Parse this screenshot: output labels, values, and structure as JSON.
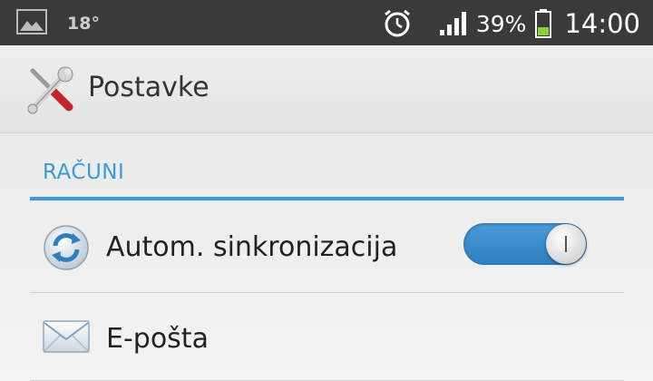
{
  "status_bar": {
    "temperature": "18°",
    "battery_percent": "39%",
    "time": "14:00",
    "icons": [
      "gallery-icon",
      "alarm-icon",
      "signal-icon",
      "battery-icon"
    ]
  },
  "action_bar": {
    "title": "Postavke",
    "icon": "settings-tools-icon"
  },
  "section": {
    "header": "RAČUNI",
    "items": [
      {
        "label": "Autom. sinkronizacija",
        "icon": "sync-icon",
        "toggle_on": true
      },
      {
        "label": "E-pošta",
        "icon": "email-envelope-icon"
      }
    ]
  },
  "colors": {
    "accent": "#3a9ad9",
    "status_bar_bg": "#3a3a3a",
    "toggle_on": "#2d7fc0"
  }
}
